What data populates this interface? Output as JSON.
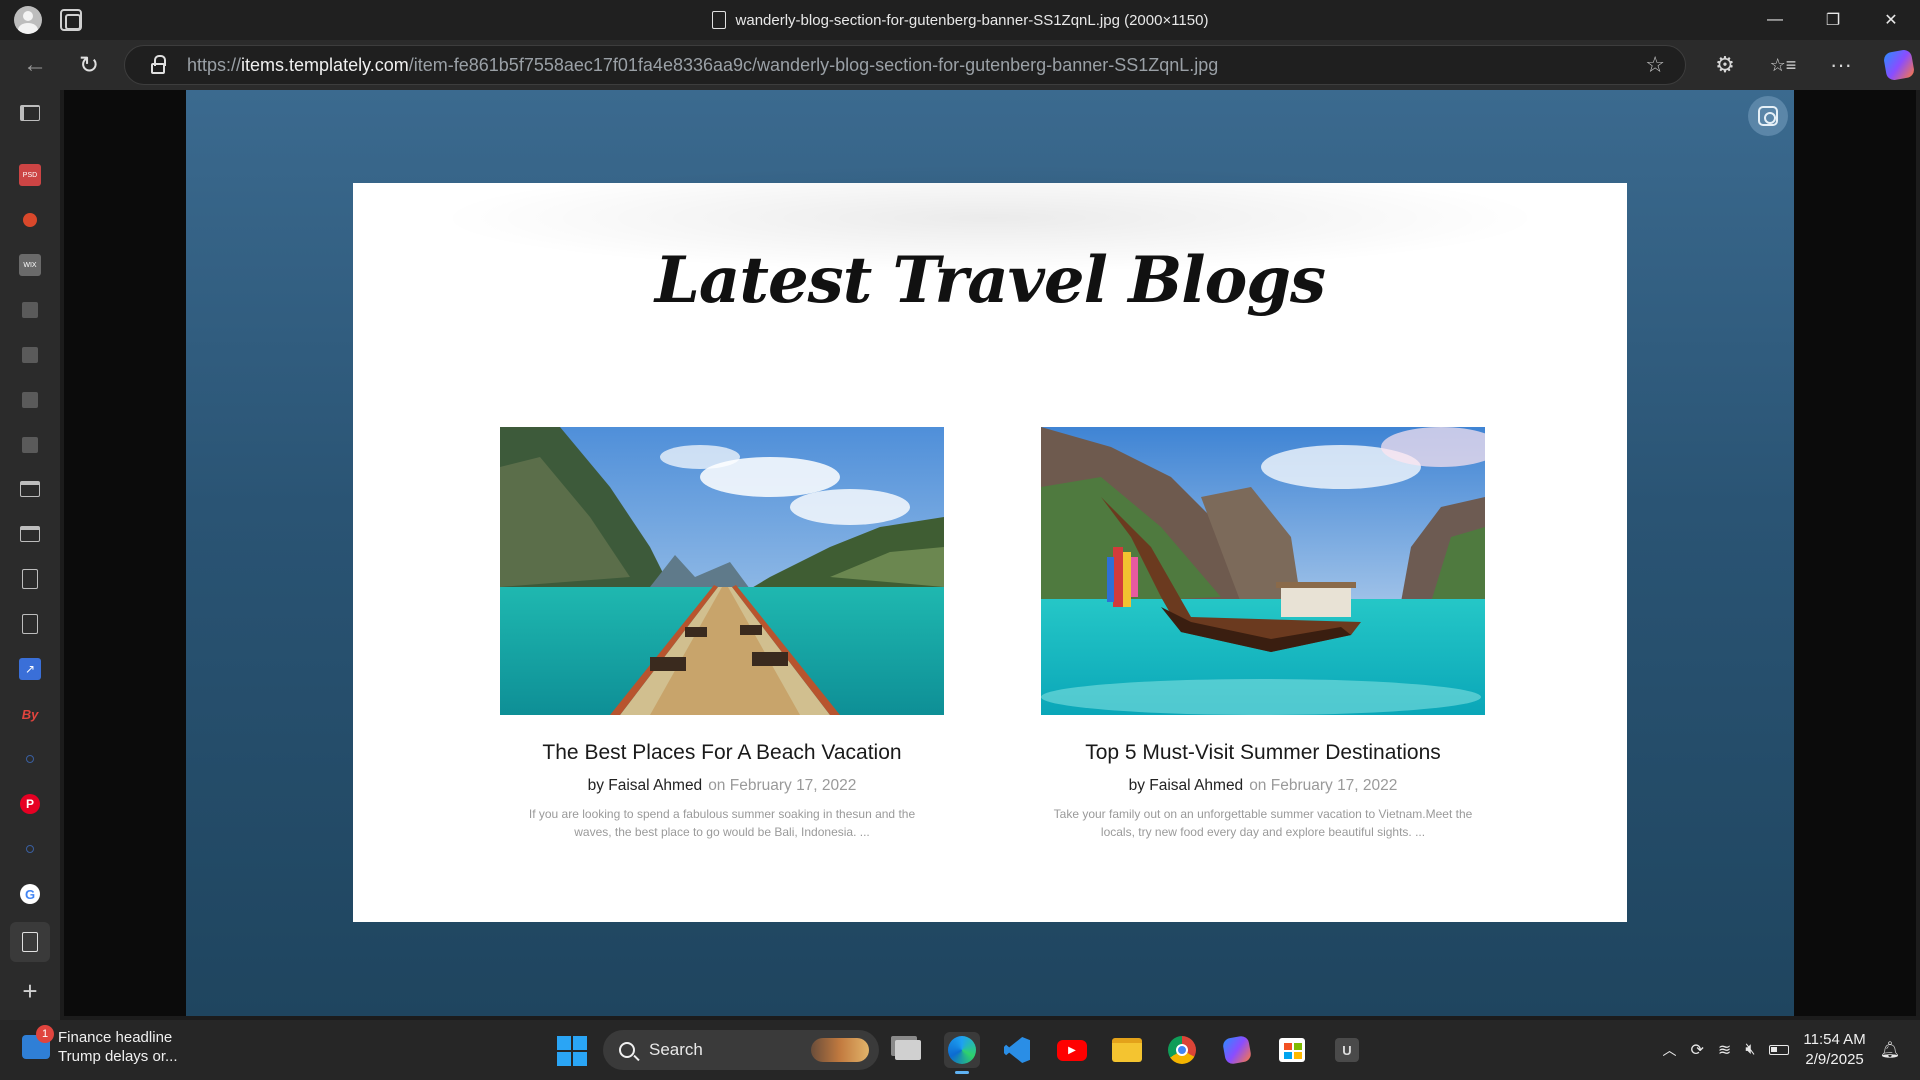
{
  "window": {
    "title": "wanderly-blog-section-for-gutenberg-banner-SS1ZqnL.jpg (2000×1150)",
    "controls": {
      "minimize": "—",
      "restore": "❐",
      "close": "✕"
    }
  },
  "addressbar": {
    "url_prefix": "https://",
    "url_host": "items.templately.com",
    "url_path": "/item-fe861b5f7558aec17f01fa4e8336aa9c/wanderly-blog-section-for-gutenberg-banner-SS1ZqnL.jpg"
  },
  "nav": {
    "back": "←",
    "reload": "↻",
    "favorite": "☆",
    "extensions": "⚙",
    "favorites": "☆≡",
    "more": "···"
  },
  "sidebar": {
    "items": [
      {
        "name": "sidebar-item-psd",
        "label": "PSD"
      },
      {
        "name": "sidebar-item-app-red",
        "label": ""
      },
      {
        "name": "sidebar-item-wix",
        "label": "WIX"
      },
      {
        "name": "sidebar-item-site-1",
        "label": ""
      },
      {
        "name": "sidebar-item-site-2",
        "label": ""
      },
      {
        "name": "sidebar-item-site-3",
        "label": ""
      },
      {
        "name": "sidebar-item-site-4",
        "label": ""
      },
      {
        "name": "sidebar-item-browser-1",
        "label": ""
      },
      {
        "name": "sidebar-item-browser-2",
        "label": ""
      },
      {
        "name": "sidebar-item-doc-1",
        "label": ""
      },
      {
        "name": "sidebar-item-doc-2",
        "label": ""
      },
      {
        "name": "sidebar-item-link",
        "label": ""
      },
      {
        "name": "sidebar-item-by",
        "label": "By"
      },
      {
        "name": "sidebar-item-search-1",
        "label": ""
      },
      {
        "name": "sidebar-item-pinterest",
        "label": "P"
      },
      {
        "name": "sidebar-item-search-2",
        "label": ""
      },
      {
        "name": "sidebar-item-google",
        "label": "G"
      },
      {
        "name": "sidebar-item-doc-active",
        "label": ""
      }
    ],
    "add": "+"
  },
  "image": {
    "heading": "Latest Travel Blogs",
    "posts": [
      {
        "title": "The Best Places For A Beach Vacation",
        "author": "by Faisal Ahmed",
        "date": "on February 17, 2022",
        "excerpt": "If you are looking to spend a fabulous summer soaking in thesun and the waves, the best place to go would be Bali, Indonesia. ..."
      },
      {
        "title": "Top 5 Must-Visit Summer Destinations",
        "author": "by Faisal Ahmed",
        "date": "on February 17, 2022",
        "excerpt": "Take your family out on an unforgettable summer vacation to Vietnam.Meet the locals, try new food every day and explore beautiful sights. ..."
      }
    ]
  },
  "taskbar": {
    "news_title": "Finance headline",
    "news_text": "Trump delays or...",
    "news_badge": "1",
    "search_label": "Search",
    "time": "11:54 AM",
    "date": "2/9/2025",
    "apps": [
      "task-view",
      "edge",
      "vscode",
      "youtube",
      "file-explorer",
      "chrome",
      "copilot",
      "microsoft-store",
      "unity"
    ]
  }
}
